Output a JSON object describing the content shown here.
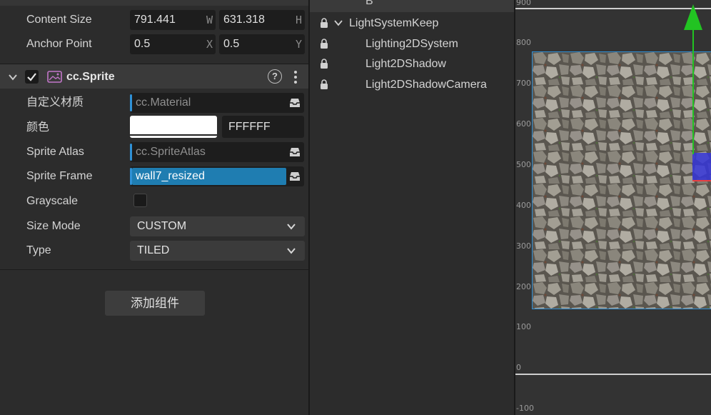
{
  "inspector": {
    "content_size": {
      "label": "Content Size",
      "w": "791.441",
      "w_axis": "W",
      "h": "631.318",
      "h_axis": "H"
    },
    "anchor_point": {
      "label": "Anchor Point",
      "x": "0.5",
      "x_axis": "X",
      "y": "0.5",
      "y_axis": "Y"
    },
    "component": {
      "title": "cc.Sprite",
      "help": "?",
      "custom_material": {
        "label": "自定义材质",
        "value": "cc.Material"
      },
      "color": {
        "label": "颜色",
        "hex": "FFFFFF",
        "swatch": "#ffffff"
      },
      "sprite_atlas": {
        "label": "Sprite Atlas",
        "value": "cc.SpriteAtlas"
      },
      "sprite_frame": {
        "label": "Sprite Frame",
        "value": "wall7_resized"
      },
      "grayscale": {
        "label": "Grayscale",
        "checked": false
      },
      "size_mode": {
        "label": "Size Mode",
        "value": "CUSTOM"
      },
      "type": {
        "label": "Type",
        "value": "TILED"
      }
    },
    "add_component_label": "添加组件"
  },
  "hierarchy": {
    "partial_top": "B",
    "nodes": [
      {
        "name": "LightSystemKeep",
        "expanded": true
      },
      {
        "name": "Lighting2DSystem"
      },
      {
        "name": "Light2DShadow"
      },
      {
        "name": "Light2DShadowCamera"
      }
    ]
  },
  "scene": {
    "ruler": [
      "900",
      "800",
      "700",
      "600",
      "500",
      "400",
      "300",
      "200",
      "100",
      "0",
      "-100"
    ],
    "colors": {
      "selection": "#2e8fd6",
      "gizmo_y": "#22c322",
      "gizmo_box": "#3535d8",
      "accent": "#1f7db1"
    }
  }
}
